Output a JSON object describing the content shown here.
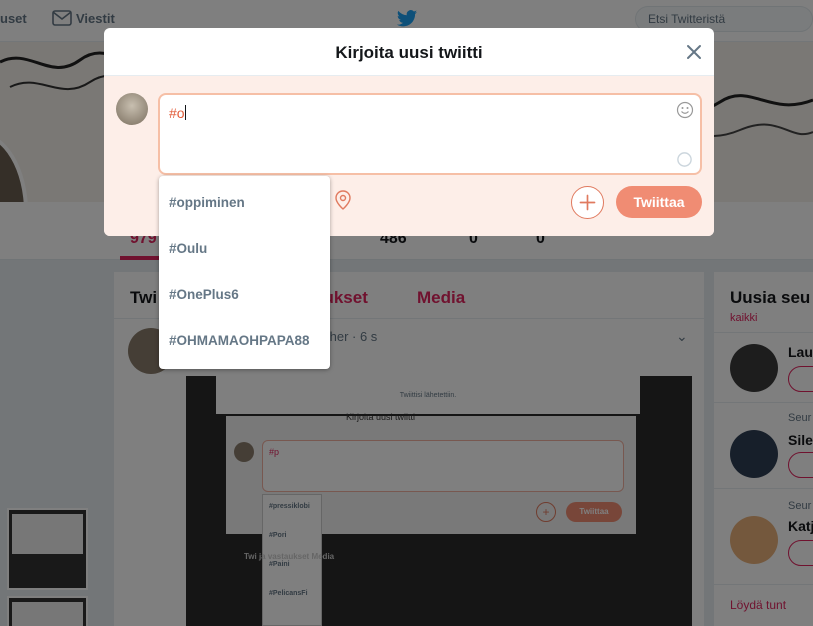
{
  "topbar": {
    "nav_partial": "uset",
    "messages_label": "Viestit",
    "search_placeholder": "Etsi Twitteristä"
  },
  "profile": {
    "stats": [
      "979",
      "486",
      "0",
      "0"
    ]
  },
  "feed": {
    "tabs": [
      "Twi",
      "aukset",
      "Media"
    ],
    "tweet_meta": "ther · 6 s"
  },
  "embedded_screenshot": {
    "toast": "Twiittisi lähetettiin.",
    "dialog_title": "Kirjoita uusi twiitti",
    "text": "#p",
    "suggestions": [
      "#pressiklobi",
      "#Pori",
      "#Paini",
      "#PelicansFi"
    ],
    "tweet_button": "Twiittaa",
    "tabs_row": "Twi          ja vastaukset       Media"
  },
  "sidebar": {
    "title": "Uusia seu",
    "all_link": "kaikki",
    "users": [
      {
        "name": "Lau",
        "follows": ""
      },
      {
        "name": "Sile",
        "follows": "Seur"
      },
      {
        "name": "Katj",
        "follows": "Seur"
      }
    ],
    "find_link": "Löydä tunt"
  },
  "modal": {
    "title": "Kirjoita uusi twiitti",
    "text_value": "#o",
    "tweet_button": "Twiittaa",
    "suggestions": [
      "#oppiminen",
      "#Oulu",
      "#OnePlus6",
      "#OHMAMAOHPAPA88"
    ]
  },
  "colors": {
    "accent": "#e0245e",
    "tweet_button": "#f08c73",
    "hashtag_text": "#e25c3a",
    "textarea_border": "#f6bfa6"
  }
}
